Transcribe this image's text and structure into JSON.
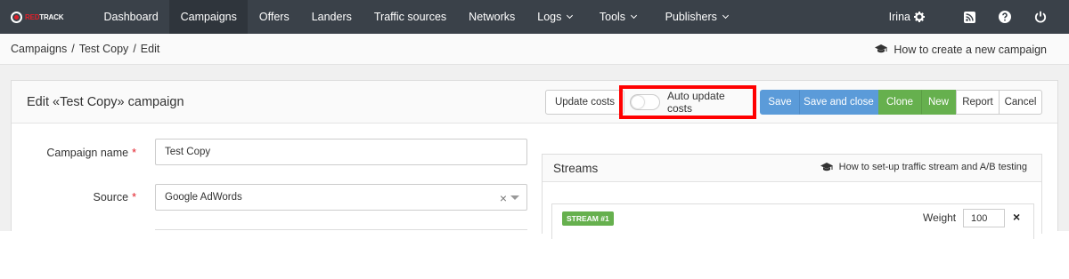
{
  "brand": {
    "logo_red": "RED",
    "logo_white": "TRACK"
  },
  "nav": {
    "items": [
      {
        "label": "Dashboard"
      },
      {
        "label": "Campaigns"
      },
      {
        "label": "Offers"
      },
      {
        "label": "Landers"
      },
      {
        "label": "Traffic sources"
      },
      {
        "label": "Networks"
      },
      {
        "label": "Logs"
      },
      {
        "label": "Tools"
      },
      {
        "label": "Publishers"
      }
    ],
    "user": "Irina"
  },
  "breadcrumb": {
    "items": [
      "Campaigns",
      "Test Copy",
      "Edit"
    ],
    "help": "How to create a new campaign"
  },
  "panel": {
    "title": "Edit «Test Copy» campaign",
    "update_costs": "Update costs",
    "auto_update": "Auto update costs",
    "save": "Save",
    "save_close": "Save and close",
    "clone": "Clone",
    "new": "New",
    "report": "Report",
    "cancel": "Cancel"
  },
  "form": {
    "name_label": "Campaign name",
    "name_value": "Test Copy",
    "source_label": "Source",
    "source_value": "Google AdWords"
  },
  "streams": {
    "title": "Streams",
    "help": "How to set-up traffic stream and A/B testing",
    "stream_badge": "STREAM #1",
    "weight_label": "Weight",
    "weight_value": "100"
  },
  "colors": {
    "nav_bg": "#3a4149",
    "primary": "#5b9bd9",
    "success": "#66b04e",
    "highlight": "#ff0000"
  }
}
